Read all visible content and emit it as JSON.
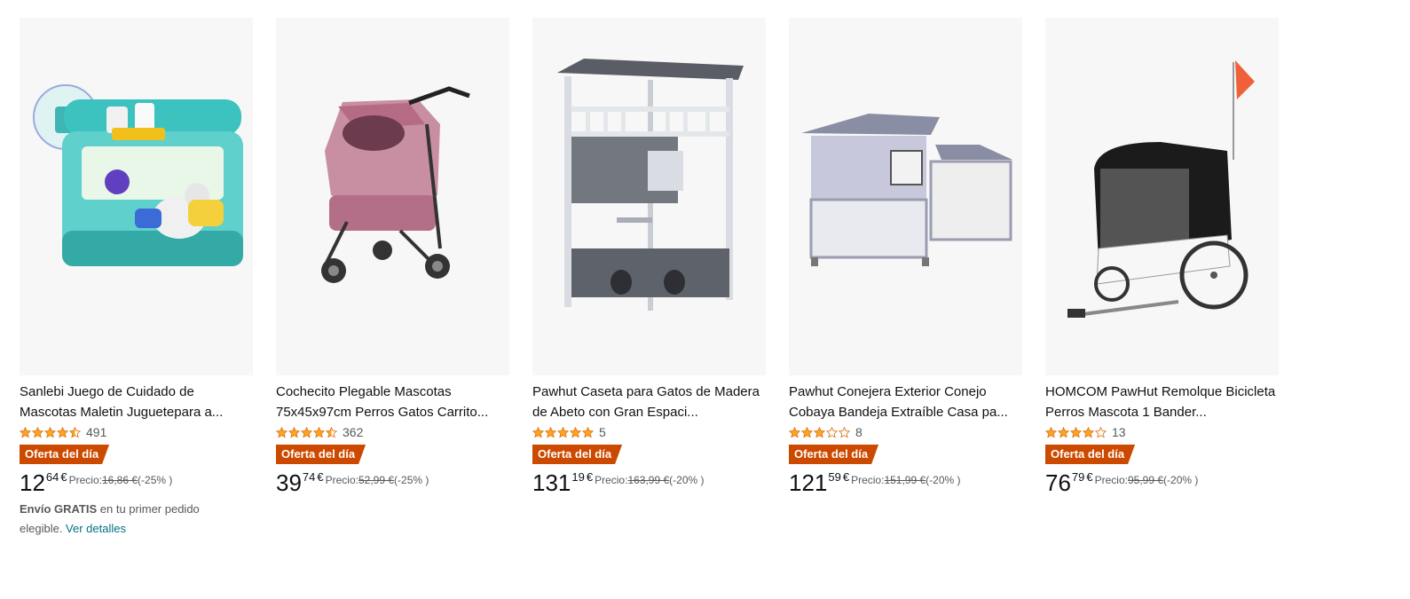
{
  "colors": {
    "deal_badge": "#cc4900",
    "star": "#ffa41c",
    "link": "#007185"
  },
  "products": [
    {
      "title": "Sanlebi Juego de Cuidado de Mascotas Maletin Juguetepara a...",
      "rating": 4.5,
      "reviews": "491",
      "badge": "Oferta del día",
      "price_whole": "12",
      "price_fraction": "64",
      "currency": "€",
      "price_label": "Precio:",
      "old_price": "16,86 €",
      "discount": "(-25% )",
      "shipping_bold": "Envío GRATIS",
      "shipping_text": " en tu primer pedido elegible. ",
      "shipping_link": "Ver detalles"
    },
    {
      "title": "Cochecito Plegable Mascotas 75x45x97cm Perros Gatos Carrito...",
      "rating": 4.5,
      "reviews": "362",
      "badge": "Oferta del día",
      "price_whole": "39",
      "price_fraction": "74",
      "currency": "€",
      "price_label": "Precio:",
      "old_price": "52,99 €",
      "discount": "(-25% )"
    },
    {
      "title": "Pawhut Caseta para Gatos de Madera de Abeto con Gran Espaci...",
      "rating": 5,
      "reviews": "5",
      "badge": "Oferta del día",
      "price_whole": "131",
      "price_fraction": "19",
      "currency": "€",
      "price_label": "Precio:",
      "old_price": "163,99 €",
      "discount": "(-20% )"
    },
    {
      "title": "Pawhut Conejera Exterior Conejo Cobaya Bandeja Extraíble Casa pa...",
      "rating": 3,
      "reviews": "8",
      "badge": "Oferta del día",
      "price_whole": "121",
      "price_fraction": "59",
      "currency": "€",
      "price_label": "Precio:",
      "old_price": "151,99 €",
      "discount": "(-20% )"
    },
    {
      "title": "HOMCOM PawHut Remolque Bicicleta Perros Mascota 1 Bander...",
      "rating": 4,
      "reviews": "13",
      "badge": "Oferta del día",
      "price_whole": "76",
      "price_fraction": "79",
      "currency": "€",
      "price_label": "Precio:",
      "old_price": "95,99 €",
      "discount": "(-20% )"
    }
  ]
}
